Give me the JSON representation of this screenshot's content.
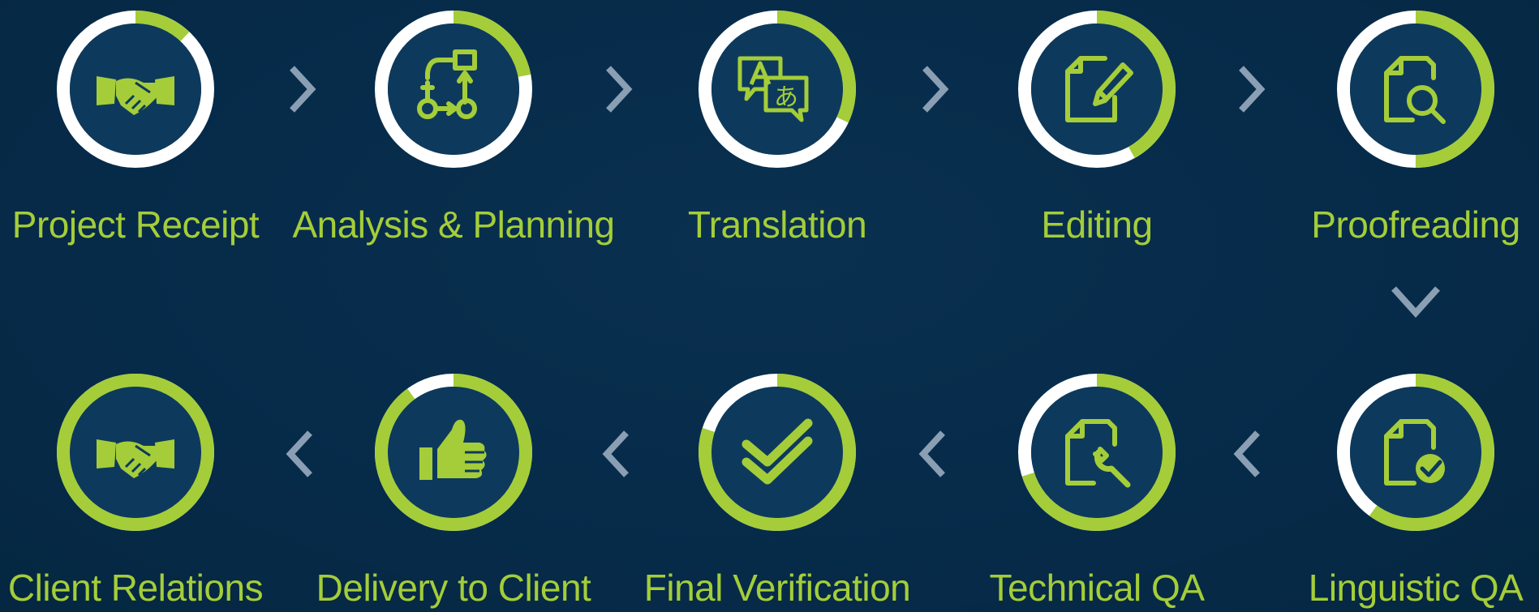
{
  "colors": {
    "background": "#062b49",
    "accent": "#a4cd39",
    "ring_track": "#ffffff",
    "inner_fill": "#0d3a5c",
    "arrow": "#8a9fb3"
  },
  "steps": [
    {
      "label": "Project Receipt",
      "icon": "handshake-icon",
      "progress": 0.12
    },
    {
      "label": "Analysis & Planning",
      "icon": "workflow-icon",
      "progress": 0.22
    },
    {
      "label": "Translation",
      "icon": "translate-icon",
      "progress": 0.32
    },
    {
      "label": "Editing",
      "icon": "edit-document-icon",
      "progress": 0.42
    },
    {
      "label": "Proofreading",
      "icon": "document-search-icon",
      "progress": 0.5
    },
    {
      "label": "Linguistic QA",
      "icon": "document-check-icon",
      "progress": 0.6
    },
    {
      "label": "Technical QA",
      "icon": "document-wrench-icon",
      "progress": 0.7
    },
    {
      "label": "Final Verification",
      "icon": "double-check-icon",
      "progress": 0.8
    },
    {
      "label": "Delivery to Client",
      "icon": "thumbs-up-icon",
      "progress": 0.9
    },
    {
      "label": "Client Relations",
      "icon": "handshake-icon",
      "progress": 1.0
    }
  ]
}
